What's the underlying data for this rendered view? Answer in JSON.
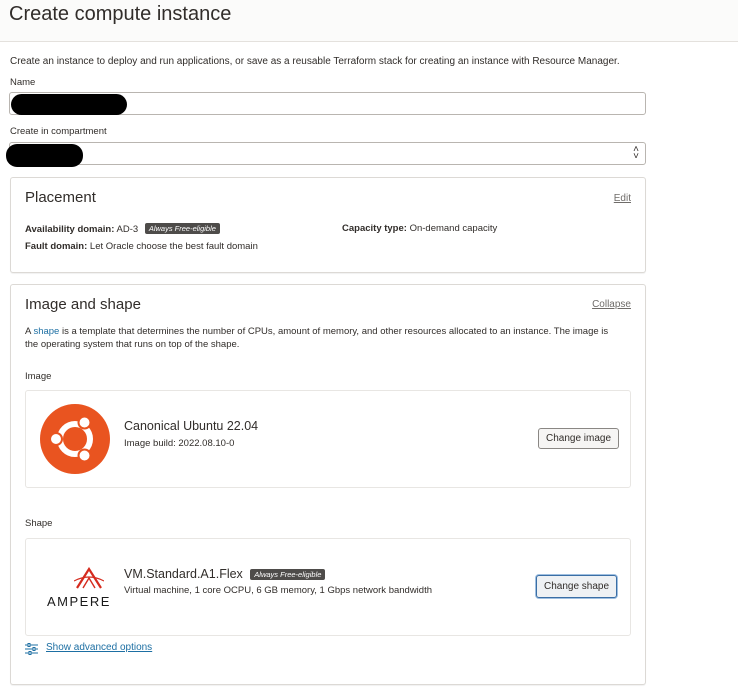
{
  "page": {
    "title": "Create compute instance"
  },
  "intro": "Create an instance to deploy and run applications, or save as a reusable Terraform stack for creating an instance with Resource Manager.",
  "name_field": {
    "label": "Name",
    "value": ""
  },
  "compartment_field": {
    "label": "Create in compartment",
    "value": ""
  },
  "placement": {
    "title": "Placement",
    "edit_label": "Edit",
    "availability_domain": {
      "label": "Availability domain:",
      "value": "AD-3",
      "badge": "Always Free-eligible"
    },
    "capacity_type": {
      "label": "Capacity type:",
      "value": "On-demand capacity"
    },
    "fault_domain": {
      "label": "Fault domain:",
      "value": "Let Oracle choose the best fault domain"
    }
  },
  "image_shape": {
    "title": "Image and shape",
    "collapse_label": "Collapse",
    "desc_prefix": "A ",
    "desc_link": "shape",
    "desc_line1": " is a template that determines the number of CPUs, amount of memory, and other resources allocated to an instance. The image is",
    "desc_line2": "the operating system that runs on top of the shape.",
    "image": {
      "section_label": "Image",
      "name": "Canonical Ubuntu 22.04",
      "build": "Image build: 2022.08.10-0",
      "button": "Change image",
      "logo_color": "#e95420"
    },
    "shape": {
      "section_label": "Shape",
      "name": "VM.Standard.A1.Flex",
      "badge": "Always Free-eligible",
      "details": "Virtual machine, 1 core OCPU, 6 GB memory, 1 Gbps network bandwidth",
      "button": "Change shape",
      "logo_text": "AMPERE",
      "logo_color": "#d52b1e"
    },
    "advanced_link": "Show advanced options"
  }
}
